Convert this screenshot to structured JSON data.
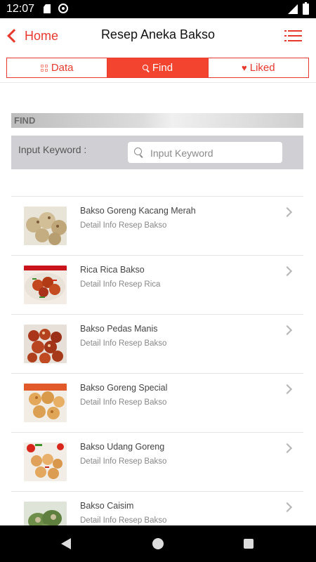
{
  "status_bar": {
    "time": "12:07"
  },
  "header": {
    "back_label": "Home",
    "title": "Resep Aneka Bakso"
  },
  "tabs": [
    {
      "label": "Data",
      "icon": "grid-icon"
    },
    {
      "label": "Find",
      "icon": "search-icon",
      "active": true
    },
    {
      "label": "Liked",
      "icon": "heart-icon"
    }
  ],
  "find": {
    "section_label": "FIND",
    "keyword_label": "Input Keyword :",
    "input_placeholder": "Input Keyword",
    "input_value": ""
  },
  "items": [
    {
      "title": "Bakso Goreng Kacang Merah",
      "subtitle": "Detail Info Resep Bakso"
    },
    {
      "title": "Rica Rica Bakso",
      "subtitle": "Detail Info Resep Rica"
    },
    {
      "title": "Bakso Pedas Manis",
      "subtitle": "Detail Info Resep Bakso"
    },
    {
      "title": "Bakso Goreng Special",
      "subtitle": "Detail Info Resep Bakso"
    },
    {
      "title": "Bakso Udang Goreng",
      "subtitle": "Detail Info Resep Bakso"
    },
    {
      "title": "Bakso Caisim",
      "subtitle": "Detail Info Resep Bakso"
    }
  ],
  "colors": {
    "accent": "#e8392e",
    "active_tab": "#f2442f"
  }
}
